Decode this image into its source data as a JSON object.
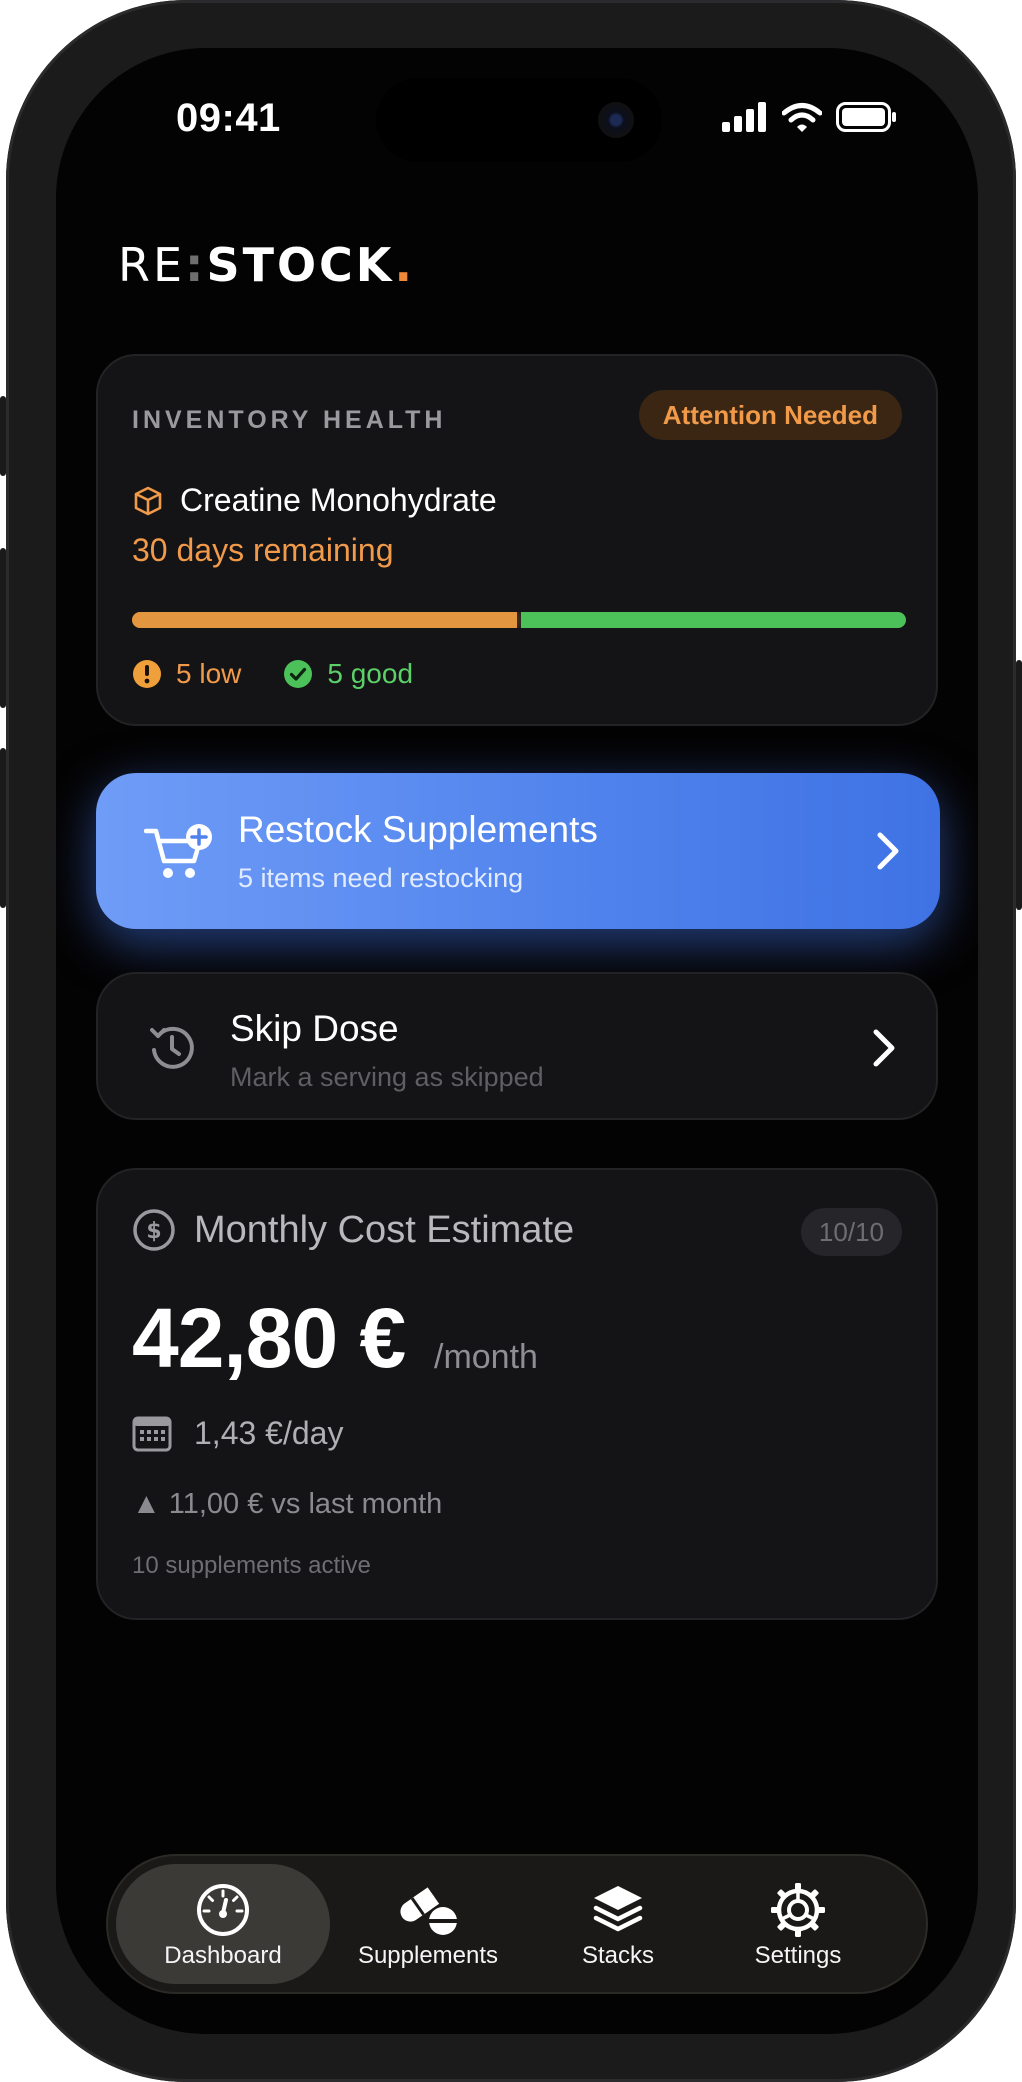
{
  "status_bar": {
    "time": "09:41"
  },
  "brand": {
    "re": "RE",
    "colon": ":",
    "stock": "STOCK",
    "dot": "."
  },
  "inventory": {
    "label": "INVENTORY HEALTH",
    "badge": "Attention Needed",
    "item_name": "Creatine Monohydrate",
    "remaining": "30 days remaining",
    "low_fraction": 0.5,
    "low_label": "5 low",
    "good_label": "5 good"
  },
  "restock": {
    "title": "Restock Supplements",
    "subtitle": "5 items need restocking"
  },
  "skip": {
    "title": "Skip Dose",
    "subtitle": "Mark a serving as skipped"
  },
  "cost": {
    "title": "Monthly Cost Estimate",
    "count": "10/10",
    "amount": "42,80 €",
    "per": "/month",
    "daily": "1,43 €/day",
    "trend": "▲ 11,00 € vs last month",
    "active": "10 supplements active"
  },
  "tabs": {
    "dashboard": "Dashboard",
    "supplements": "Supplements",
    "stacks": "Stacks",
    "settings": "Settings"
  },
  "colors": {
    "accent_orange": "#f19a49",
    "accent_green": "#4cc15a",
    "primary_blue": "#4f82ec"
  }
}
